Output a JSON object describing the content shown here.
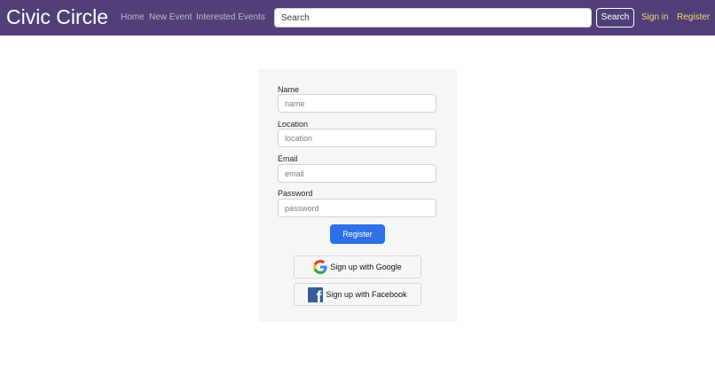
{
  "navbar": {
    "brand": "Civic Circle",
    "links": [
      "Home",
      "New Event",
      "Interested Events"
    ],
    "search": {
      "placeholder": "Search",
      "value": "",
      "button_label": "Search"
    },
    "auth": {
      "signin_label": "Sign in",
      "register_label": "Register"
    },
    "colors": {
      "background": "#503f78",
      "auth_link": "#f5d87a"
    }
  },
  "form": {
    "fields": [
      {
        "label": "Name",
        "placeholder": "name"
      },
      {
        "label": "Location",
        "placeholder": "location"
      },
      {
        "label": "Email",
        "placeholder": "email"
      },
      {
        "label": "Password",
        "placeholder": "password"
      }
    ],
    "register_label": "Register",
    "google_label": "Sign up with Google",
    "facebook_label": "Sign up with Facebook",
    "google_icon": "google-g-icon",
    "facebook_icon": "facebook-f-icon",
    "colors": {
      "primary_button": "#2f6fe8",
      "facebook": "#3b5a99"
    }
  }
}
